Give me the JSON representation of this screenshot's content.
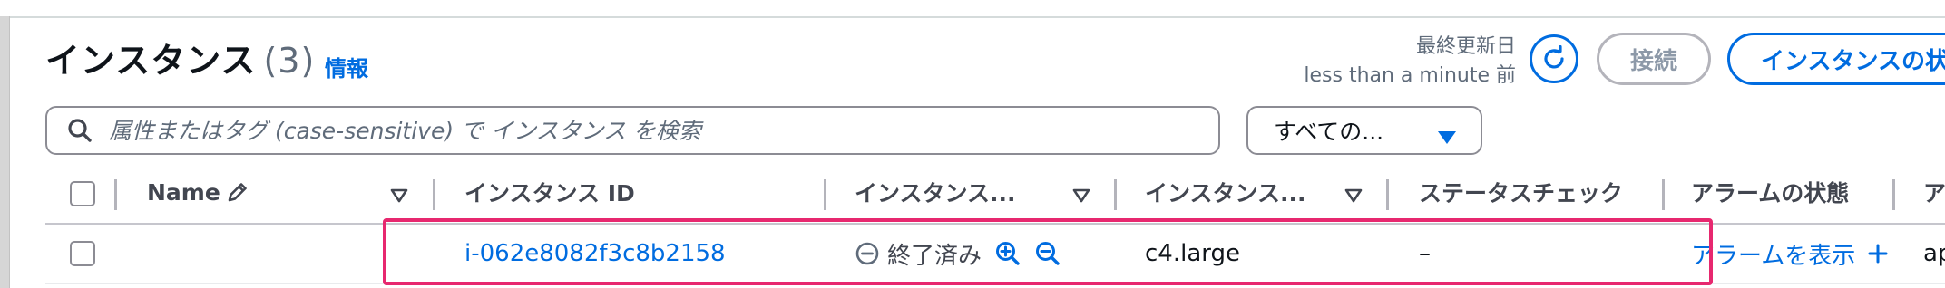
{
  "header": {
    "title": "インスタンス",
    "count": "(3)",
    "info_link": "情報",
    "last_updated_label": "最終更新日",
    "last_updated_value": "less than a minute 前",
    "connect_label": "接続",
    "instance_state_label": "インスタンスの状"
  },
  "search": {
    "placeholder": "属性またはタグ (case-sensitive) で インスタンス を検索",
    "value": ""
  },
  "filter": {
    "selected": "すべての..."
  },
  "table": {
    "columns": [
      {
        "label": "Name"
      },
      {
        "label": "インスタンス ID"
      },
      {
        "label": "インスタンス..."
      },
      {
        "label": "インスタンス..."
      },
      {
        "label": "ステータスチェック"
      },
      {
        "label": "アラームの状態"
      },
      {
        "label": "ア"
      }
    ],
    "rows": [
      {
        "name": "",
        "instance_id": "i-062e8082f3c8b2158",
        "state": "終了済み",
        "type": "c4.large",
        "status_check": "–",
        "alarm": "アラームを表示",
        "az": "ap"
      }
    ]
  },
  "colors": {
    "accent": "#006ce0",
    "highlight": "#e7286f",
    "muted": "#5f6b7a"
  },
  "icons": [
    "search-icon",
    "refresh-icon",
    "pencil-icon",
    "sort-caret-icon",
    "caret-down-icon",
    "terminated-icon",
    "zoom-in-icon",
    "zoom-out-icon",
    "plus-icon"
  ]
}
